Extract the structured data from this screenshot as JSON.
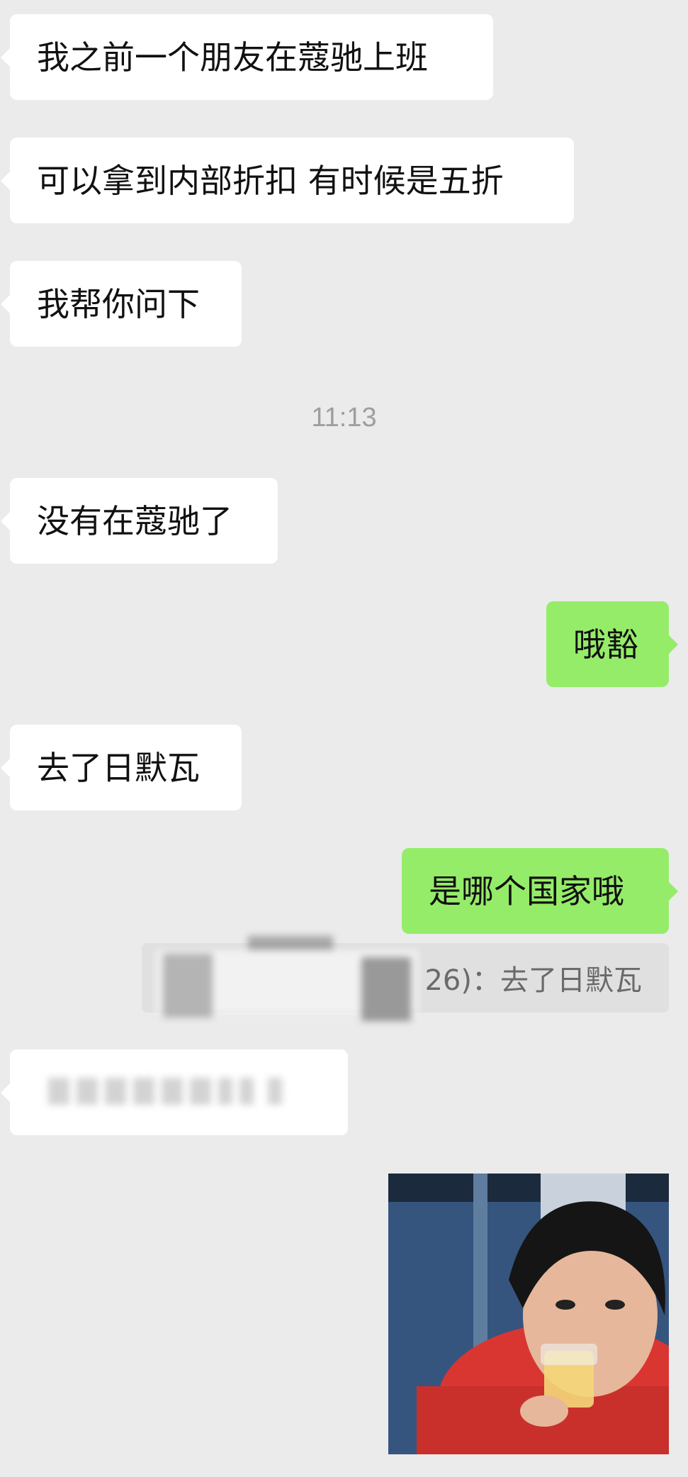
{
  "chat": {
    "messages": [
      {
        "side": "left",
        "text": "我之前一个朋友在蔻驰上班"
      },
      {
        "side": "left",
        "text": "可以拿到内部折扣 有时候是五折"
      },
      {
        "side": "left",
        "text": "我帮你问下"
      },
      {
        "side": "left",
        "text": "没有在蔻驰了"
      },
      {
        "side": "right",
        "text": "哦豁"
      },
      {
        "side": "left",
        "text": "去了日默瓦"
      },
      {
        "side": "right",
        "text": "是哪个国家哦"
      }
    ],
    "timestamp": "11:13",
    "quote": {
      "visible_suffix": "26)：去了日默瓦",
      "quoted_text": "去了日默瓦"
    },
    "redacted_message": {
      "text": ""
    },
    "photo": {
      "icon": "sticker-photo-woman-drinking"
    }
  },
  "colors": {
    "background": "#ebebeb",
    "incoming_bubble": "#ffffff",
    "outgoing_bubble": "#95ec69",
    "timestamp": "#9e9e9e"
  }
}
